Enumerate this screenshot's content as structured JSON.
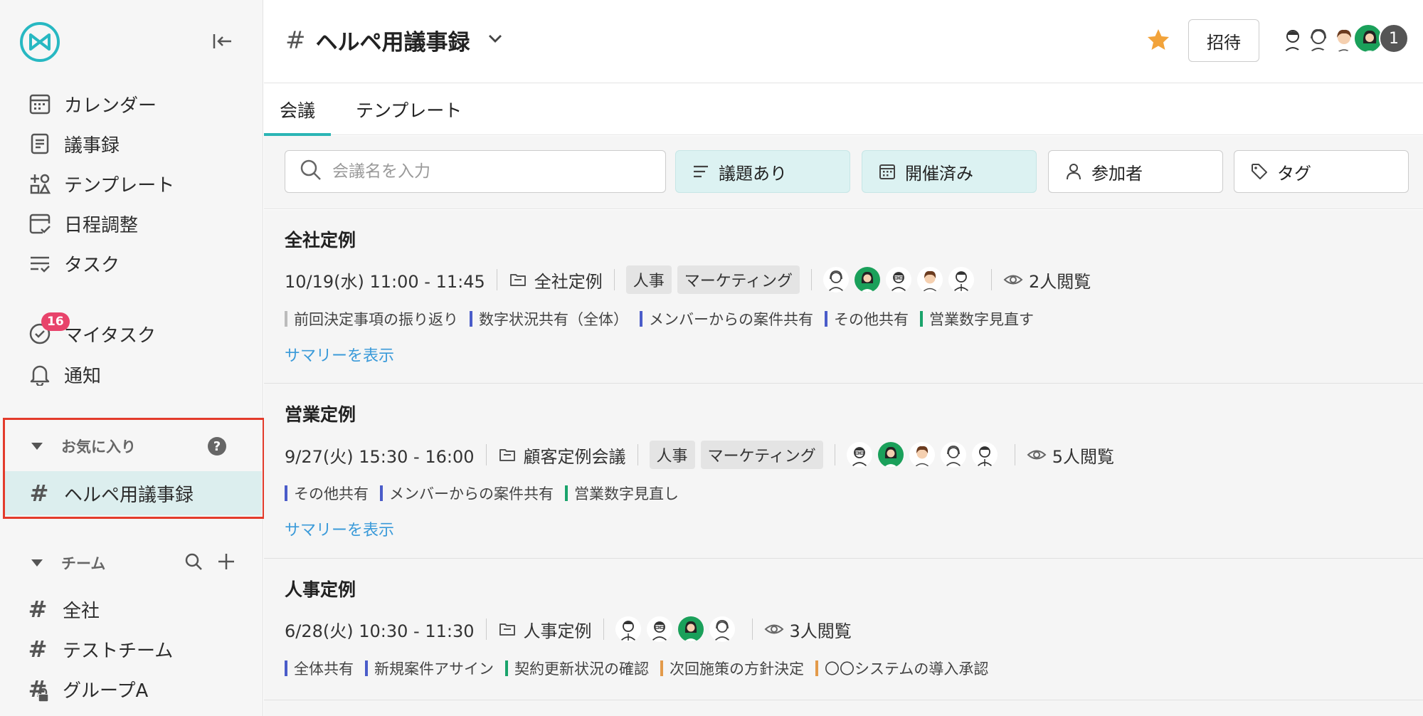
{
  "sidebar": {
    "nav": [
      {
        "label": "カレンダー",
        "icon": "calendar-icon"
      },
      {
        "label": "議事録",
        "icon": "document-icon"
      },
      {
        "label": "テンプレート",
        "icon": "template-icon"
      },
      {
        "label": "日程調整",
        "icon": "schedule-icon"
      },
      {
        "label": "タスク",
        "icon": "task-list-icon"
      }
    ],
    "my_tasks": {
      "label": "マイタスク",
      "badge": "16",
      "icon": "check-circle-icon"
    },
    "notifications": {
      "label": "通知",
      "icon": "bell-icon"
    },
    "favorites": {
      "title": "お気に入り",
      "help": "?",
      "item": "ヘルペ用議事録"
    },
    "team": {
      "title": "チーム",
      "items": [
        "全社",
        "テストチーム",
        "グループA"
      ]
    }
  },
  "header": {
    "hash": "#",
    "title": "ヘルペ用議事録",
    "invite": "招待",
    "member_count": "1",
    "star_color": "#f2a33a"
  },
  "tabs": [
    "会議",
    "テンプレート"
  ],
  "filters": {
    "search_placeholder": "会議名を入力",
    "buttons": [
      "議題あり",
      "開催済み",
      "参加者",
      "タグ"
    ]
  },
  "meetings": [
    {
      "title": "全社定例",
      "datetime": "10/19(水) 11:00 - 11:45",
      "folder": "全社定例",
      "tags": [
        "人事",
        "マーケティング"
      ],
      "views": "2人閲覧",
      "agenda": [
        {
          "text": "前回決定事項の振り返り",
          "color": "#bbbbbb"
        },
        {
          "text": "数字状況共有（全体）",
          "color": "#4a5cc9"
        },
        {
          "text": "メンバーからの案件共有",
          "color": "#4a5cc9"
        },
        {
          "text": "その他共有",
          "color": "#4a5cc9"
        },
        {
          "text": "営業数字見直す",
          "color": "#1aa36b"
        }
      ],
      "summary": "サマリーを表示"
    },
    {
      "title": "営業定例",
      "datetime": "9/27(火) 15:30 - 16:00",
      "folder": "顧客定例会議",
      "tags": [
        "人事",
        "マーケティング"
      ],
      "views": "5人閲覧",
      "agenda": [
        {
          "text": "その他共有",
          "color": "#4a5cc9"
        },
        {
          "text": "メンバーからの案件共有",
          "color": "#4a5cc9"
        },
        {
          "text": "営業数字見直し",
          "color": "#1aa36b"
        }
      ],
      "summary": "サマリーを表示"
    },
    {
      "title": "人事定例",
      "datetime": "6/28(火) 10:30 - 11:30",
      "folder": "人事定例",
      "tags": [],
      "views": "3人閲覧",
      "agenda": [
        {
          "text": "全体共有",
          "color": "#4a5cc9"
        },
        {
          "text": "新規案件アサイン",
          "color": "#4a5cc9"
        },
        {
          "text": "契約更新状況の確認",
          "color": "#1aa36b"
        },
        {
          "text": "次回施策の方針決定",
          "color": "#e39a4a"
        },
        {
          "text": "〇〇システムの導入承認",
          "color": "#e39a4a"
        }
      ]
    }
  ]
}
